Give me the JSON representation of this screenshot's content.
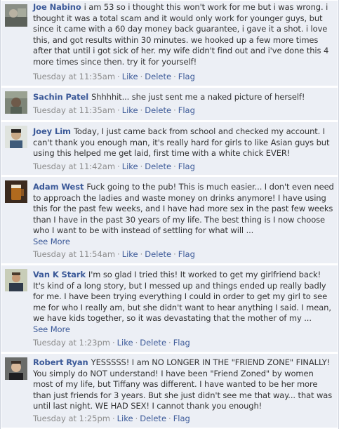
{
  "comments": [
    {
      "name": "Joe Nabino",
      "text": "i am 53 so i thought this won't work for me but i was wrong. i thought it was a total scam and it would only work for younger guys, but since it came with a 60 day money back guarantee, i gave it a shot.  i love this, and got results within 30 minutes.  we hooked up a few more times after that until i got sick of her. my wife didn't find out and i've done this 4 more times since then. try it for yourself!",
      "see_more": "",
      "time": "Tuesday at 11:35am",
      "like": "Like",
      "delete": "Delete",
      "flag": "Flag"
    },
    {
      "name": "Sachin Patel",
      "text": "Shhhhit... she just sent me a naked picture of herself!",
      "see_more": "",
      "time": "Tuesday at 11:35am",
      "like": "Like",
      "delete": "Delete",
      "flag": "Flag"
    },
    {
      "name": "Joey Lim",
      "text": "Today, I just came back from school and checked my account. I can't thank you enough man, it's really hard for girls to like Asian guys but using this helped me get laid, first time with a white chick EVER!",
      "see_more": "",
      "time": "Tuesday at 11:42am",
      "like": "Like",
      "delete": "Delete",
      "flag": "Flag"
    },
    {
      "name": "Adam West",
      "text": "Fuck going to the pub! This is much easier... I don't even need to approach the ladies and waste money on drinks anymore! I have using this for the past few weeks, and I have had more sex in the past few weeks than I have in the past 30 years of my life. The best thing is I now choose who I want to be with instead of settling for what will ...",
      "see_more": "See More",
      "time": "Tuesday at 11:54am",
      "like": "Like",
      "delete": "Delete",
      "flag": "Flag"
    },
    {
      "name": "Van K Stark",
      "text": "I'm so glad I tried this! It worked to get my girlfriend back! It's kind of a long story, but I messed up and things ended up really badly for me. I have been trying everything I could in order to get my girl to see me for who I really am, but she didn't want to hear anything I said. I mean, we have kids together, so it was devastating that the mother of my ...",
      "see_more": "See More",
      "time": "Tuesday at 1:23pm",
      "like": "Like",
      "delete": "Delete",
      "flag": "Flag"
    },
    {
      "name": "Robert Ryan",
      "text": "YESSSSS! I am NO LONGER IN THE \"FRIEND ZONE\" FINALLY! You simply do NOT understand! I have been \"Friend Zoned\" by women most of my life, but Tiffany was different. I have wanted to be her more than just friends for 3 years. But she just didn't see me that way... that was until last night. WE HAD SEX! I cannot thank you enough!",
      "see_more": "",
      "time": "Tuesday at 1:25pm",
      "like": "Like",
      "delete": "Delete",
      "flag": "Flag"
    }
  ]
}
